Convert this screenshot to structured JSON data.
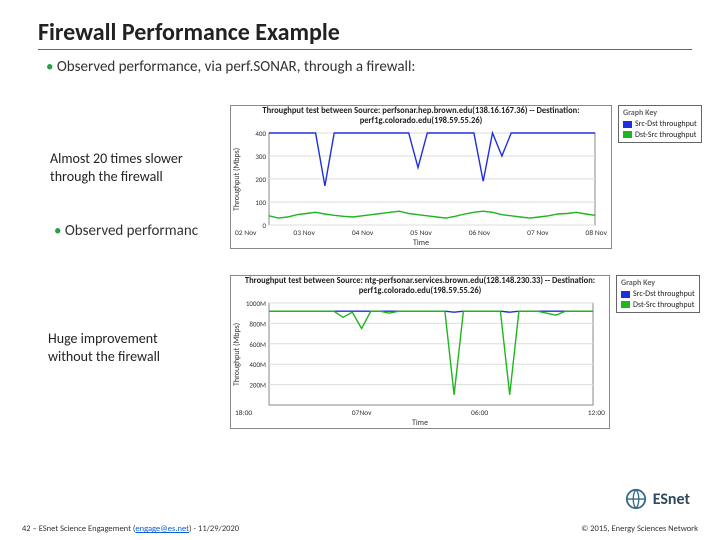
{
  "title": "Firewall Performance Example",
  "bullet1": "Observed performance, via perf.SONAR, through a firewall:",
  "bullet2_partial": "Observed performanc",
  "annotation1": "Almost 20 times slower through the firewall",
  "annotation2": "Huge improvement without the firewall",
  "chart_data": [
    {
      "type": "line",
      "title": "Throughput test between Source: perfsonar.hep.brown.edu(138.16.167.36) -- Destination: perf1g.colorado.edu(198.59.55.26)",
      "xlabel": "Time",
      "ylabel": "Throughput (Mbps)",
      "ylim": [
        0,
        400
      ],
      "yticks": [
        0,
        100,
        200,
        300,
        400
      ],
      "categories": [
        "02 Nov",
        "03 Nov",
        "04 Nov",
        "05 Nov",
        "06 Nov",
        "07 Nov",
        "08 Nov"
      ],
      "series": [
        {
          "name": "Src-Dst throughput",
          "color": "#1f2fe0",
          "values": [
            400,
            400,
            400,
            400,
            400,
            400,
            170,
            400,
            400,
            400,
            400,
            400,
            400,
            400,
            400,
            400,
            250,
            400,
            400,
            400,
            400,
            400,
            400,
            190,
            400,
            300,
            400,
            400,
            400,
            400,
            400,
            400,
            400,
            400,
            400,
            400
          ]
        },
        {
          "name": "Dst-Src throughput",
          "color": "#1fb51f",
          "values": [
            40,
            30,
            35,
            45,
            50,
            55,
            48,
            42,
            38,
            35,
            40,
            45,
            50,
            55,
            60,
            50,
            45,
            40,
            35,
            30,
            38,
            48,
            55,
            60,
            55,
            45,
            40,
            35,
            30,
            35,
            40,
            48,
            50,
            55,
            48,
            42
          ]
        }
      ],
      "legend_title": "Graph Key"
    },
    {
      "type": "line",
      "title": "Throughput test between Source: ntg-perfsonar.services.brown.edu(128.148.230.33) -- Destination: perf1g.colorado.edu(198.59.55.26)",
      "xlabel": "Time",
      "ylabel": "Throughput (Mbps)",
      "ylim": [
        0,
        1000
      ],
      "yticks": [
        "1000M",
        "800M",
        "600M",
        "400M",
        "200M"
      ],
      "categories": [
        "18:00",
        "07Nov",
        "06:00",
        "12:00"
      ],
      "series": [
        {
          "name": "Src-Dst throughput",
          "color": "#1f2fe0",
          "values": [
            920,
            920,
            920,
            920,
            920,
            920,
            920,
            920,
            920,
            920,
            920,
            920,
            920,
            920,
            920,
            920,
            920,
            920,
            920,
            920,
            910,
            920,
            920,
            920,
            920,
            920,
            910,
            920,
            920,
            920,
            920,
            920,
            920,
            920,
            920,
            920
          ]
        },
        {
          "name": "Dst-Src throughput",
          "color": "#1fb51f",
          "values": [
            920,
            920,
            920,
            920,
            920,
            920,
            920,
            920,
            860,
            910,
            750,
            920,
            920,
            900,
            920,
            920,
            920,
            920,
            920,
            920,
            100,
            920,
            920,
            920,
            920,
            920,
            100,
            920,
            920,
            920,
            900,
            880,
            920,
            920,
            920,
            920
          ]
        }
      ],
      "legend_title": "Graph Key"
    }
  ],
  "colors": {
    "blue": "#1f2fe0",
    "green": "#1fb51f"
  },
  "logo_text": "ESnet",
  "footer_left_prefix": "42 – ESnet Science Engagement (",
  "footer_email": "engage@es.net",
  "footer_left_suffix": ") - 11/29/2020",
  "footer_right": "© 2015, Energy Sciences Network"
}
